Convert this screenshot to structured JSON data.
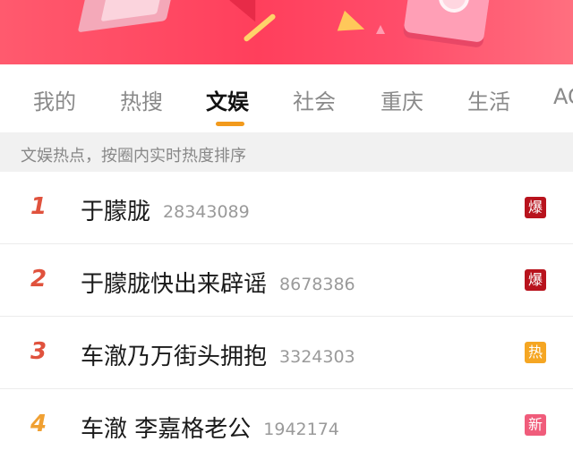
{
  "tabs": [
    {
      "label": "我的"
    },
    {
      "label": "热搜"
    },
    {
      "label": "文娱"
    },
    {
      "label": "社会"
    },
    {
      "label": "重庆"
    },
    {
      "label": "生活"
    },
    {
      "label": "AC"
    }
  ],
  "active_tab": "文娱",
  "subheader": "文娱热点，按圈内实时热度排序",
  "items": [
    {
      "rank": "1",
      "title": "于朦胧",
      "count": "28343089",
      "badge": "爆",
      "badge_color": "#b8131d",
      "rank_color": "#e0523d"
    },
    {
      "rank": "2",
      "title": "于朦胧快出来辟谣",
      "count": "8678386",
      "badge": "爆",
      "badge_color": "#b8131d",
      "rank_color": "#e0523d"
    },
    {
      "rank": "3",
      "title": "车澈乃万街头拥抱",
      "count": "3324303",
      "badge": "热",
      "badge_color": "#f5a623",
      "rank_color": "#e0523d"
    },
    {
      "rank": "4",
      "title": "车澈 李嘉格老公",
      "count": "1942174",
      "badge": "新",
      "badge_color": "#f05c7b",
      "rank_color": "#f0a032"
    }
  ],
  "colors": {
    "banner": "#ff3f5c",
    "tab_indicator": "#f29a1c"
  }
}
